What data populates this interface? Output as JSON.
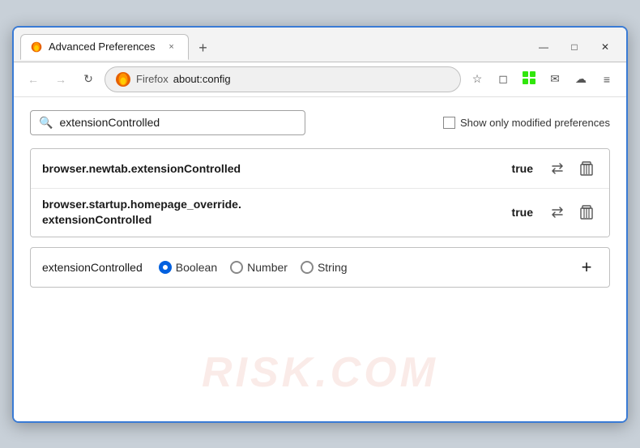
{
  "window": {
    "title": "Advanced Preferences",
    "tab_close": "×",
    "new_tab": "+",
    "win_minimize": "—",
    "win_maximize": "□",
    "win_close": "✕"
  },
  "nav": {
    "back_label": "←",
    "forward_label": "→",
    "reload_label": "↻",
    "browser_name": "Firefox",
    "url": "about:config",
    "bookmark_icon": "☆",
    "pocket_icon": "◻",
    "extension_icon": "⊞",
    "profile_icon": "✉",
    "account_icon": "☁",
    "menu_icon": "≡"
  },
  "search": {
    "value": "extensionControlled",
    "placeholder": "Search preference name",
    "show_modified_label": "Show only modified preferences"
  },
  "results": [
    {
      "name": "browser.newtab.extensionControlled",
      "value": "true"
    },
    {
      "name": "browser.startup.homepage_override.\nextensionControlled",
      "name_line1": "browser.startup.homepage_override.",
      "name_line2": "extensionControlled",
      "value": "true",
      "multiline": true
    }
  ],
  "add_row": {
    "pref_name": "extensionControlled",
    "type_boolean": "Boolean",
    "type_number": "Number",
    "type_string": "String",
    "add_label": "+",
    "selected_type": "Boolean"
  },
  "watermark": "RISK.COM",
  "icons": {
    "swap": "⇄",
    "delete": "🗑",
    "search": "🔍"
  }
}
